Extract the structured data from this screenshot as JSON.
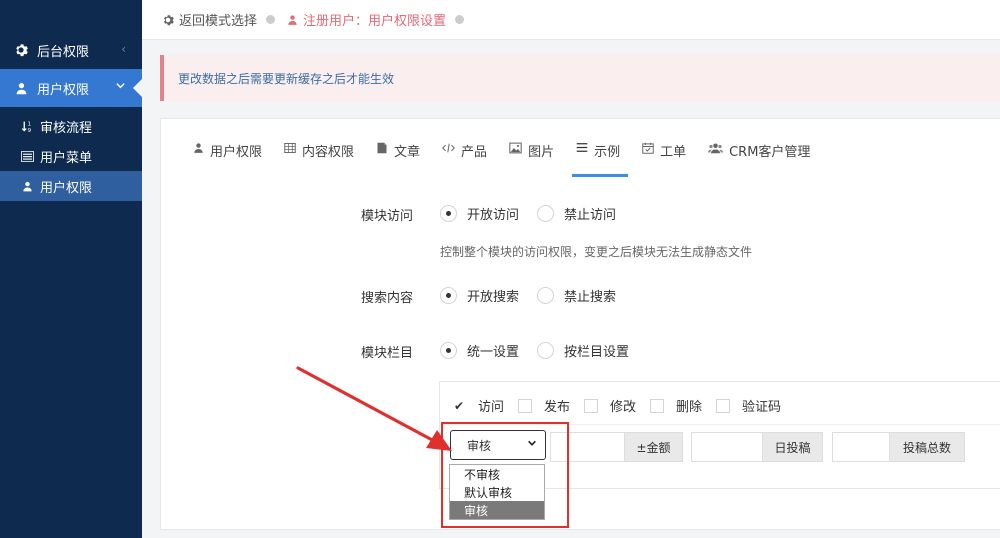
{
  "sidebar": {
    "groups": [
      {
        "label": "后台权限",
        "icon": "gear-icon",
        "arrow": "‹"
      },
      {
        "label": "用户权限",
        "icon": "user-icon",
        "arrow": "⌄"
      }
    ],
    "items": [
      {
        "label": "审核流程",
        "icon": "sort-icon"
      },
      {
        "label": "用户菜单",
        "icon": "list-icon"
      },
      {
        "label": "用户权限",
        "icon": "user-icon"
      }
    ]
  },
  "breadcrumb": {
    "back": "返回模式选择",
    "current": "注册用户：用户权限设置"
  },
  "alert": {
    "text": "更改数据之后需要更新缓存之后才能生效"
  },
  "tabs": [
    {
      "label": "用户权限",
      "icon": "user-icon"
    },
    {
      "label": "内容权限",
      "icon": "table-icon"
    },
    {
      "label": "文章",
      "icon": "doc-icon"
    },
    {
      "label": "产品",
      "icon": "code-icon"
    },
    {
      "label": "图片",
      "icon": "image-icon"
    },
    {
      "label": "示例",
      "icon": "menu-icon"
    },
    {
      "label": "工单",
      "icon": "calendar-check-icon"
    },
    {
      "label": "CRM客户管理",
      "icon": "users-icon"
    }
  ],
  "active_tab": "示例",
  "form": {
    "module_access": {
      "label": "模块访问",
      "options": [
        "开放访问",
        "禁止访问"
      ],
      "selected": "开放访问",
      "hint": "控制整个模块的访问权限，变更之后模块无法生成静态文件"
    },
    "search": {
      "label": "搜索内容",
      "options": [
        "开放搜索",
        "禁止搜索"
      ],
      "selected": "开放搜索"
    },
    "column": {
      "label": "模块栏目",
      "options": [
        "统一设置",
        "按栏目设置"
      ],
      "selected": "统一设置"
    },
    "permissions": [
      {
        "label": "访问",
        "checked": true
      },
      {
        "label": "发布",
        "checked": false
      },
      {
        "label": "修改",
        "checked": false
      },
      {
        "label": "删除",
        "checked": false
      },
      {
        "label": "验证码",
        "checked": false
      }
    ],
    "review_select": {
      "value": "审核",
      "options": [
        "不审核",
        "默认审核",
        "审核"
      ]
    },
    "addons": [
      "±金额",
      "日投稿",
      "投稿总数"
    ]
  },
  "colors": {
    "sidebar_bg": "#0e2b4f",
    "sidebar_active": "#3478d2",
    "tab_underline": "#3b8ee2",
    "annotation_red": "#e0302d"
  }
}
